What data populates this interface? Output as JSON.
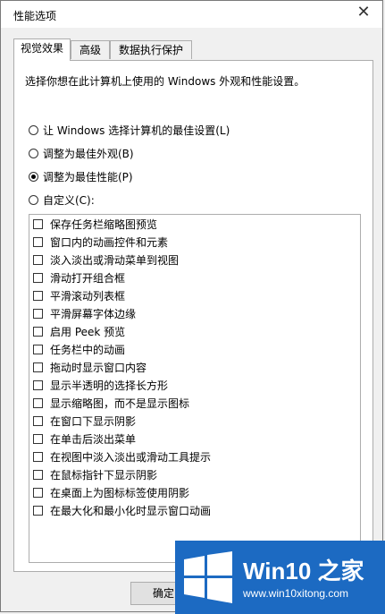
{
  "window": {
    "title": "性能选项",
    "close_glyph": "✕"
  },
  "tabs": [
    {
      "label": "视觉效果",
      "active": true
    },
    {
      "label": "高级",
      "active": false
    },
    {
      "label": "数据执行保护",
      "active": false
    }
  ],
  "panel": {
    "description": "选择你想在此计算机上使用的 Windows 外观和性能设置。",
    "radios": [
      {
        "label": "让 Windows 选择计算机的最佳设置(L)",
        "selected": false
      },
      {
        "label": "调整为最佳外观(B)",
        "selected": false
      },
      {
        "label": "调整为最佳性能(P)",
        "selected": true
      },
      {
        "label": "自定义(C):",
        "selected": false
      }
    ],
    "options": [
      {
        "label": "保存任务栏缩略图预览",
        "checked": false
      },
      {
        "label": "窗口内的动画控件和元素",
        "checked": false
      },
      {
        "label": "淡入淡出或滑动菜单到视图",
        "checked": false
      },
      {
        "label": "滑动打开组合框",
        "checked": false
      },
      {
        "label": "平滑滚动列表框",
        "checked": false
      },
      {
        "label": "平滑屏幕字体边缘",
        "checked": false
      },
      {
        "label": "启用 Peek 预览",
        "checked": false
      },
      {
        "label": "任务栏中的动画",
        "checked": false
      },
      {
        "label": "拖动时显示窗口内容",
        "checked": false
      },
      {
        "label": "显示半透明的选择长方形",
        "checked": false
      },
      {
        "label": "显示缩略图，而不是显示图标",
        "checked": false
      },
      {
        "label": "在窗口下显示阴影",
        "checked": false
      },
      {
        "label": "在单击后淡出菜单",
        "checked": false
      },
      {
        "label": "在视图中淡入淡出或滑动工具提示",
        "checked": false
      },
      {
        "label": "在鼠标指针下显示阴影",
        "checked": false
      },
      {
        "label": "在桌面上为图标标签使用阴影",
        "checked": false
      },
      {
        "label": "在最大化和最小化时显示窗口动画",
        "checked": false
      }
    ]
  },
  "buttons": {
    "ok": "确定"
  },
  "watermark": {
    "brand": "Win10 之家",
    "url": "www.win10xitong.com",
    "color": "#1c6ac2"
  }
}
